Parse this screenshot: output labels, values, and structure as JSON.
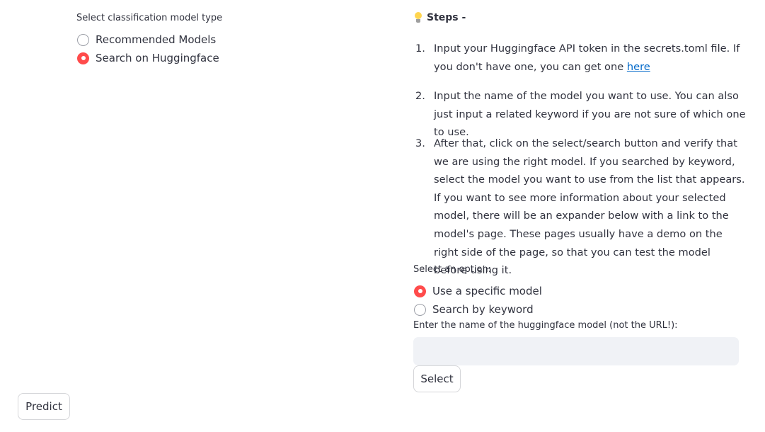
{
  "left_panel": {
    "model_type_label": "Select classification model type",
    "model_type_options": [
      {
        "label": "Recommended Models",
        "selected": false
      },
      {
        "label": "Search on Huggingface",
        "selected": true
      }
    ]
  },
  "steps": {
    "icon": "lightbulb-icon",
    "title": "Steps -",
    "items": [
      {
        "number": "1.",
        "text": "Input your Huggingface API token in the secrets.toml file. If you don't have one, you can get one ",
        "link_text": "here"
      },
      {
        "number": "2.",
        "text": "Input the name of the model you want to use. You can also just input a related keyword if you are not sure of which one to use."
      },
      {
        "number": "3.",
        "text": "After that, click on the select/search button and verify that we are using the right model. If you searched by keyword, select the model you want to use from the list that appears. If you want to see more information about your selected model, there will be an expander below with a link to the model's page. These pages usually have a demo on the right side of the page, so that you can test the model before using it."
      }
    ]
  },
  "option_select": {
    "label": "Select an option:",
    "options": [
      {
        "label": "Use a specific model",
        "selected": true
      },
      {
        "label": "Search by keyword",
        "selected": false
      }
    ]
  },
  "model_input": {
    "label": "Enter the name of the huggingface model (not the URL!):",
    "value": "",
    "placeholder": ""
  },
  "buttons": {
    "select_label": "Select",
    "predict_label": "Predict"
  },
  "colors": {
    "accent": "#ff4b4b",
    "link": "#0068c9",
    "input_bg": "#f0f2f6",
    "text": "#31333f"
  }
}
